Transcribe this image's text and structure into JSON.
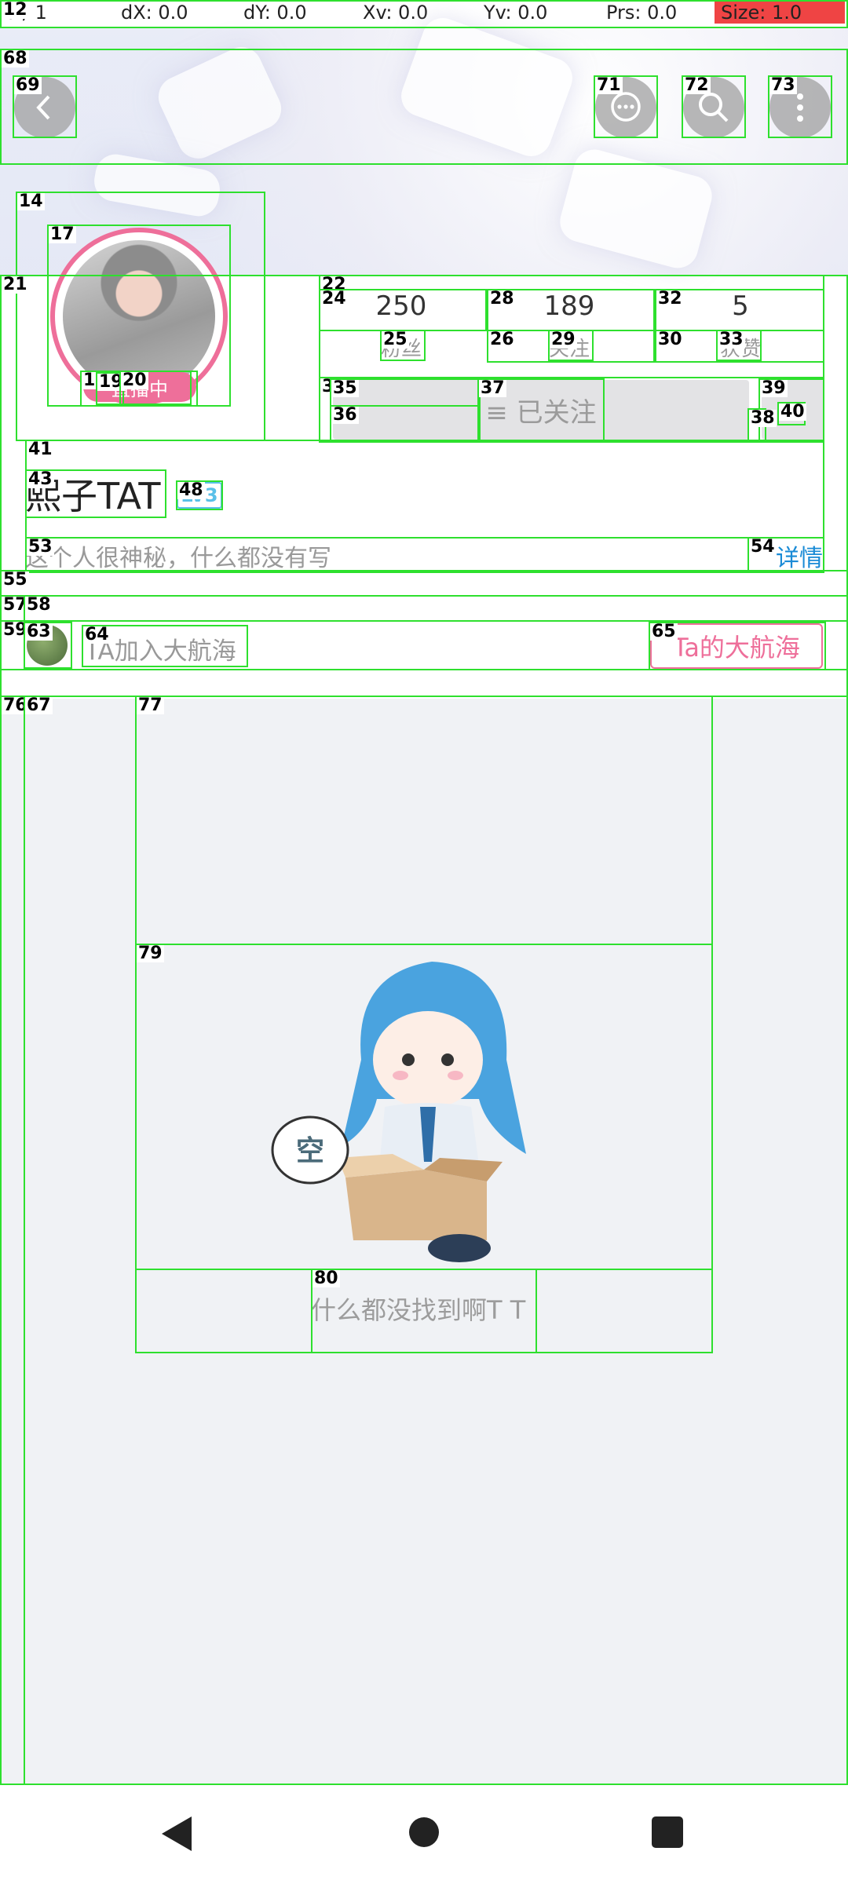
{
  "debug": {
    "pointer": "0 / 1",
    "dx": "dX: 0.0",
    "dy": "dY: 0.0",
    "xv": "Xv: 0.0",
    "yv": "Yv: 0.0",
    "prs": "Prs: 0.0",
    "size": "Size: 1.0"
  },
  "header": {
    "back_icon": "chevron-left-icon",
    "chat_icon": "chat-bubble-icon",
    "search_icon": "search-icon",
    "more_icon": "more-vertical-icon"
  },
  "profile": {
    "live_label": "直播中",
    "stats": [
      {
        "value": "250",
        "label": "粉丝"
      },
      {
        "value": "189",
        "label": "关注"
      },
      {
        "value": "5",
        "label": "获赞"
      }
    ],
    "follow_state": "≡ 已关注",
    "name": "熙子TAT",
    "level_badge": "LV3",
    "bio": "这个人很神秘，什么都没有写",
    "detail_link": "详情"
  },
  "fleet": {
    "text": "TA加入大航海",
    "button": "Ta的大航海"
  },
  "empty": {
    "message": "什么都没找到啊T T",
    "illustration_text": "空"
  },
  "navbar": {
    "back": "nav-back-icon",
    "home": "nav-home-icon",
    "recents": "nav-recents-icon"
  },
  "colors": {
    "accent_pink": "#ee6f9a",
    "link_blue": "#1a8bd6",
    "debug_highlight": "#ef4444",
    "overlay_green": "#2ee02e"
  },
  "overlay_ids": [
    "12",
    "68",
    "69",
    "71",
    "72",
    "73",
    "14",
    "17",
    "18",
    "19",
    "20",
    "21",
    "22",
    "24",
    "28",
    "26",
    "32",
    "30",
    "25",
    "29",
    "33",
    "3",
    "35",
    "36",
    "37",
    "39",
    "38",
    "40",
    "41",
    "43",
    "48",
    "53",
    "54",
    "55",
    "57",
    "58",
    "59",
    "63",
    "64",
    "65",
    "76",
    "67",
    "77",
    "79",
    "80"
  ]
}
